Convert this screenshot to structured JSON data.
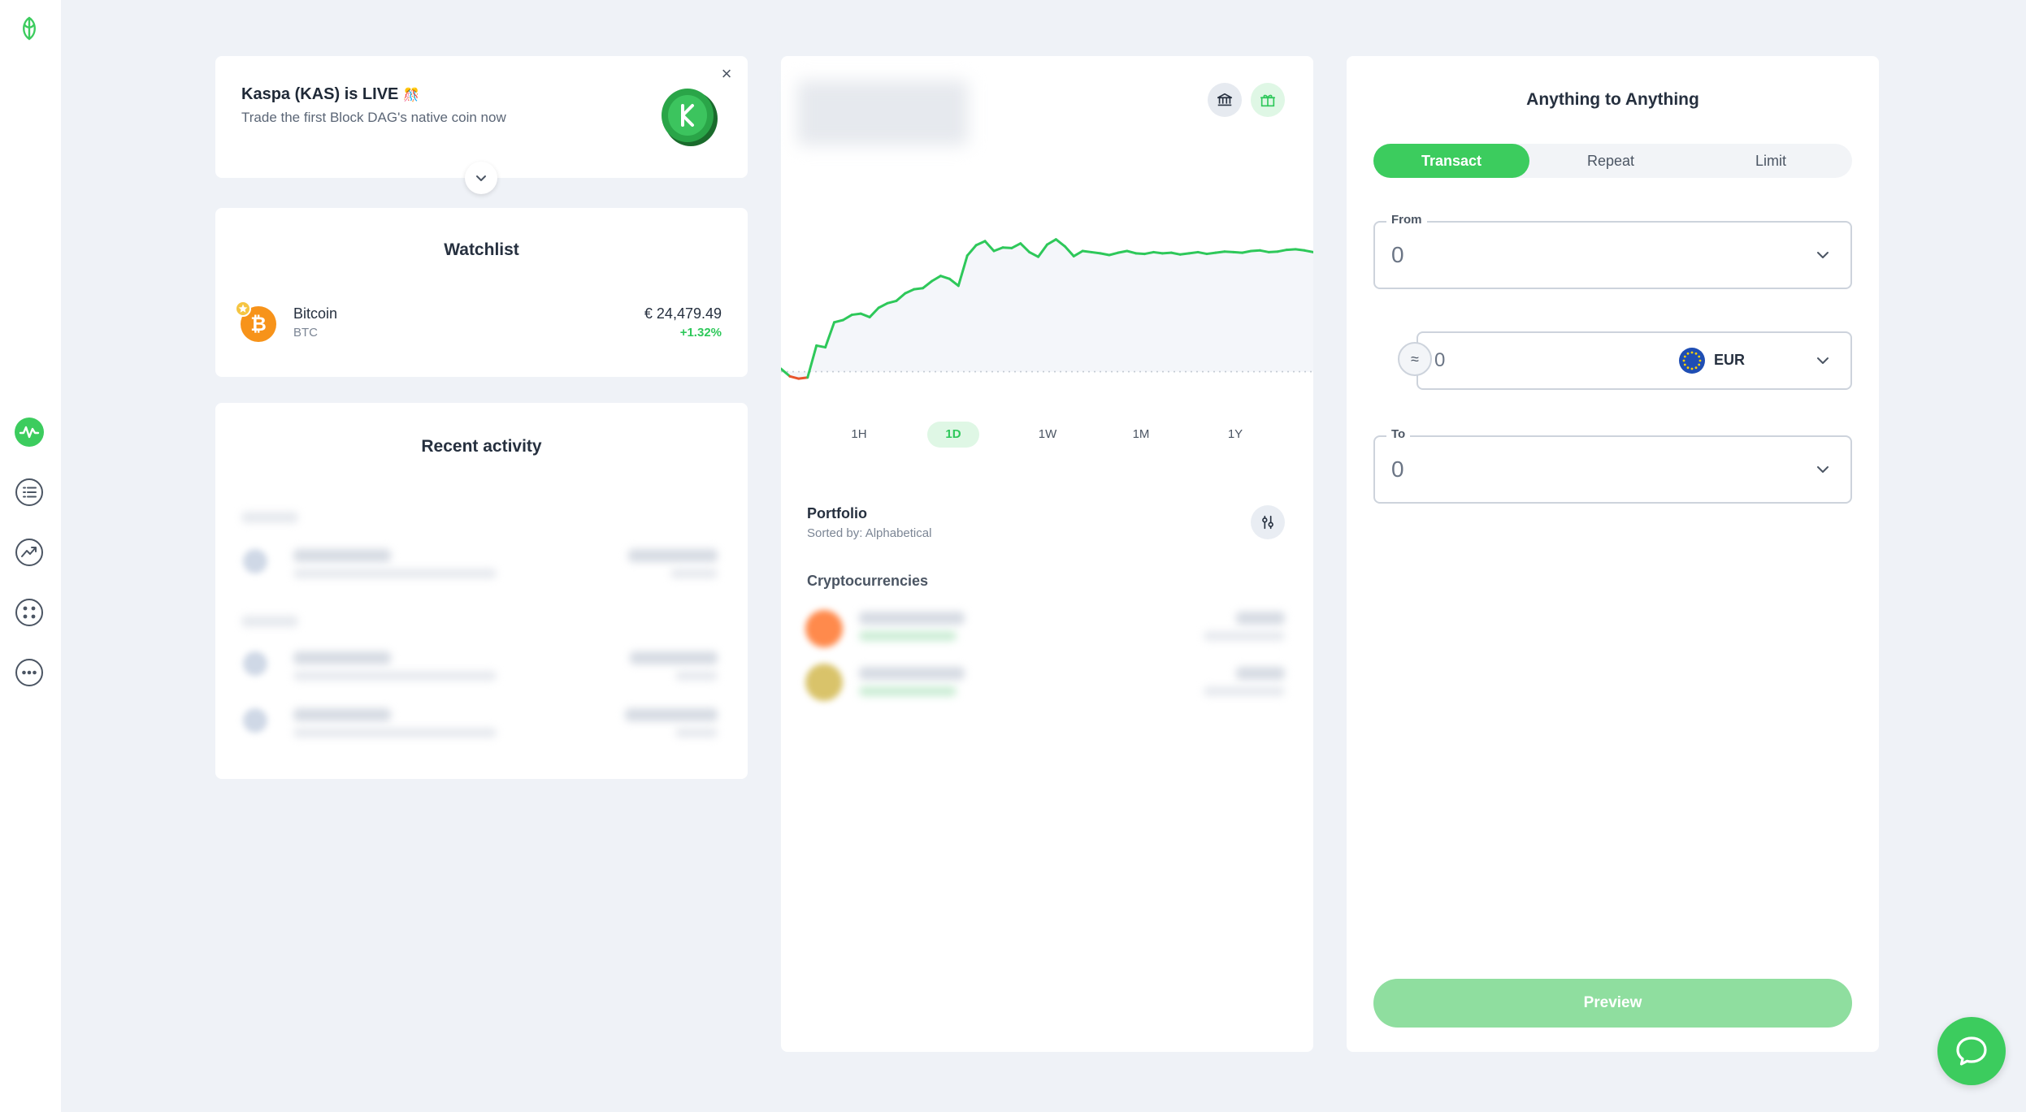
{
  "colors": {
    "accent": "#3ccc5e",
    "positive": "#2ec85a",
    "negative": "#e8532b",
    "background": "#eff2f7",
    "card": "#ffffff"
  },
  "sidebar": {
    "items": [
      {
        "icon": "uphold-logo-icon"
      },
      {
        "icon": "activity-icon",
        "active": true
      },
      {
        "icon": "list-icon"
      },
      {
        "icon": "trending-icon"
      },
      {
        "icon": "apps-icon"
      },
      {
        "icon": "more-icon"
      }
    ]
  },
  "banner": {
    "title": "Kaspa (KAS) is LIVE",
    "emoji": "🎊",
    "subtitle": "Trade the first Block DAG's native coin now",
    "close": "×",
    "coin_icon": "kaspa-coin-icon",
    "expand_icon": "chevron-down-icon"
  },
  "watchlist": {
    "title": "Watchlist",
    "items": [
      {
        "name": "Bitcoin",
        "symbol": "BTC",
        "price": "€ 24,479.49",
        "change": "+1.32%",
        "icon": "bitcoin-icon"
      }
    ]
  },
  "recent_activity": {
    "title": "Recent activity"
  },
  "chart": {
    "header_buttons": [
      {
        "icon": "bank-icon"
      },
      {
        "icon": "gift-icon"
      }
    ],
    "timeframes": [
      "1H",
      "1D",
      "1W",
      "1M",
      "1Y"
    ],
    "active_timeframe": "1D"
  },
  "chart_data": {
    "type": "line",
    "x": [
      0,
      1,
      2,
      3,
      4,
      5,
      6,
      7,
      8,
      9,
      10,
      11,
      12,
      13,
      14,
      15,
      16,
      17,
      18,
      19,
      20,
      21,
      22,
      23,
      24,
      25,
      26,
      27,
      28,
      29,
      30,
      31,
      32,
      33,
      34,
      35,
      36,
      37,
      38,
      39,
      40,
      41,
      42,
      43,
      44,
      45,
      46,
      47,
      48,
      49,
      50,
      51,
      52,
      53,
      54,
      55,
      56,
      57,
      58,
      59,
      60
    ],
    "y": [
      97.5,
      96.2,
      95.8,
      96.0,
      101.5,
      101.2,
      105.5,
      105.9,
      106.8,
      107.0,
      106.4,
      108.0,
      108.8,
      109.2,
      110.5,
      111.2,
      111.4,
      112.6,
      113.5,
      113.0,
      111.8,
      117.0,
      118.8,
      119.5,
      117.8,
      118.4,
      118.3,
      119.1,
      117.6,
      116.8,
      118.9,
      119.8,
      118.6,
      116.9,
      117.8,
      117.6,
      117.4,
      117.1,
      117.5,
      117.8,
      117.4,
      117.3,
      117.6,
      117.4,
      117.5,
      117.2,
      117.4,
      117.6,
      117.3,
      117.5,
      117.7,
      117.6,
      117.5,
      117.8,
      117.9,
      117.6,
      117.7,
      118.0,
      118.1,
      117.9,
      117.6
    ],
    "baseline": 97.0,
    "ylim": [
      94,
      122
    ],
    "series_colors": {
      "above": "#2ec85a",
      "below": "#e8532b"
    },
    "grid": false
  },
  "portfolio": {
    "title": "Portfolio",
    "subtitle": "Sorted by: Alphabetical",
    "sort_icon": "sliders-icon",
    "section": "Cryptocurrencies"
  },
  "exchange": {
    "title": "Anything to Anything",
    "tabs": [
      "Transact",
      "Repeat",
      "Limit"
    ],
    "active_tab": "Transact",
    "from_label": "From",
    "from_value": "0",
    "amount_value": "0",
    "currency": "EUR",
    "conversion_icon": "≈",
    "to_label": "To",
    "to_value": "0",
    "preview_label": "Preview"
  },
  "support": {
    "icon": "chat-bubble-icon"
  }
}
